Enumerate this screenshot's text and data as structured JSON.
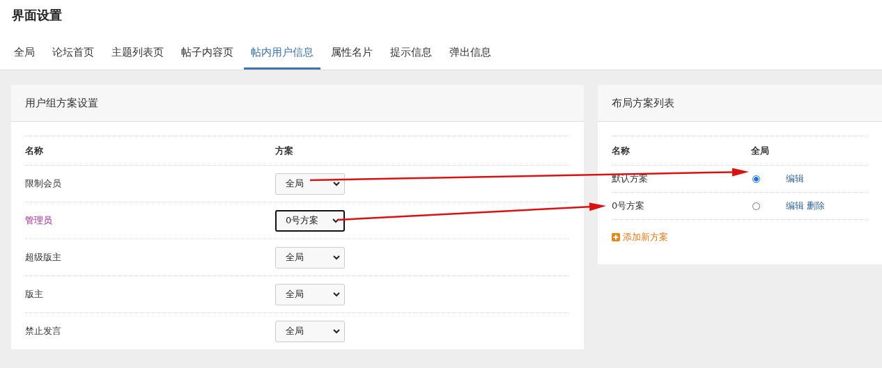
{
  "page": {
    "title": "界面设置"
  },
  "tabs": [
    {
      "label": "全局",
      "selected": false
    },
    {
      "label": "论坛首页",
      "selected": false
    },
    {
      "label": "主题列表页",
      "selected": false
    },
    {
      "label": "帖子内容页",
      "selected": false
    },
    {
      "label": "帖内用户信息",
      "selected": true
    },
    {
      "label": "属性名片",
      "selected": false
    },
    {
      "label": "提示信息",
      "selected": false
    },
    {
      "label": "弹出信息",
      "selected": false
    }
  ],
  "group_panel": {
    "title": "用户组方案设置",
    "columns": [
      "名称",
      "方案"
    ],
    "rows": [
      {
        "name": "限制会员",
        "highlighted": false,
        "scheme": "全局",
        "focused": false
      },
      {
        "name": "管理员",
        "highlighted": true,
        "scheme": "0号方案",
        "focused": true
      },
      {
        "name": "超级版主",
        "highlighted": false,
        "scheme": "全局",
        "focused": false
      },
      {
        "name": "版主",
        "highlighted": false,
        "scheme": "全局",
        "focused": false
      },
      {
        "name": "禁止发言",
        "highlighted": false,
        "scheme": "全局",
        "focused": false
      }
    ]
  },
  "layout_panel": {
    "title": "布局方案列表",
    "columns": [
      "名称",
      "全局"
    ],
    "rows": [
      {
        "name": "默认方案",
        "selected": true,
        "actions": [
          "编辑"
        ]
      },
      {
        "name": "0号方案",
        "selected": false,
        "actions": [
          "编辑",
          "删除"
        ]
      }
    ],
    "add_link": "添加新方案"
  },
  "annotations": [
    {
      "kind": "arrow"
    },
    {
      "kind": "arrow"
    }
  ]
}
